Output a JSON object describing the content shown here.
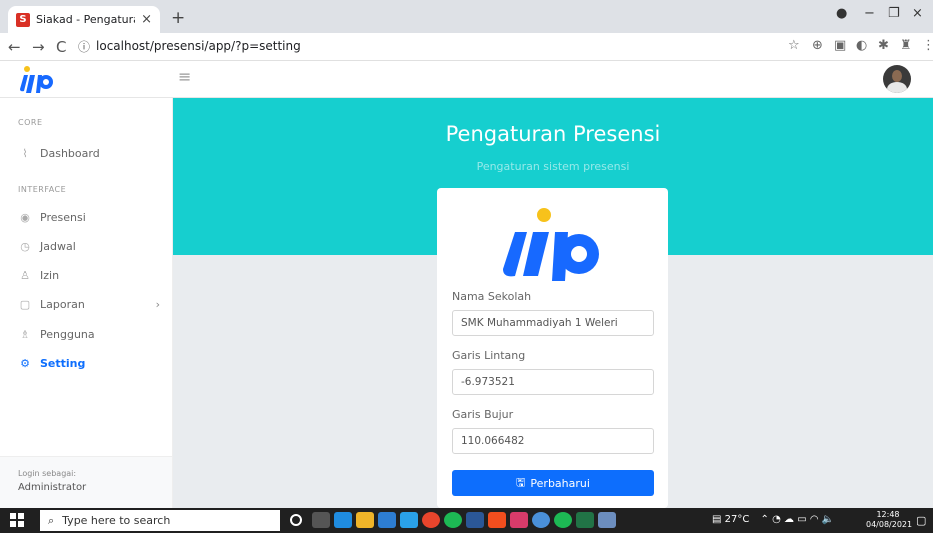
{
  "browser": {
    "tab_title": "Siakad - Pengaturan Presensi",
    "tab_favicon": "S",
    "tab_close": "×",
    "new_tab": "+",
    "url": "localhost/presensi/app/?p=setting"
  },
  "sidebar": {
    "section_core": "CORE",
    "dashboard": "Dashboard",
    "section_interface": "INTERFACE",
    "items": [
      {
        "label": "Presensi",
        "icon": "fingerprint-icon"
      },
      {
        "label": "Jadwal",
        "icon": "clock-icon"
      },
      {
        "label": "Izin",
        "icon": "user-check-icon"
      },
      {
        "label": "Laporan",
        "icon": "document-icon"
      },
      {
        "label": "Pengguna",
        "icon": "users-icon"
      },
      {
        "label": "Setting",
        "icon": "gear-icon"
      }
    ],
    "login_label": "Login sebagai:",
    "login_role": "Administrator"
  },
  "main": {
    "title": "Pengaturan Presensi",
    "subtitle": "Pengaturan sistem presensi",
    "fields": {
      "school_label": "Nama Sekolah",
      "school_value": "SMK Muhammadiyah 1 Weleri",
      "lat_label": "Garis Lintang",
      "lat_value": "-6.973521",
      "lng_label": "Garis Bujur",
      "lng_value": "110.066482"
    },
    "submit_label": "Perbaharui"
  },
  "taskbar": {
    "search_placeholder": "Type here to search",
    "weather": "27°C",
    "time": "12:48",
    "date": "04/08/2021"
  },
  "colors": {
    "hero": "#16cfcf",
    "primary": "#0d6efd",
    "logo_blue": "#1769ff",
    "logo_dot": "#f7c21b"
  }
}
